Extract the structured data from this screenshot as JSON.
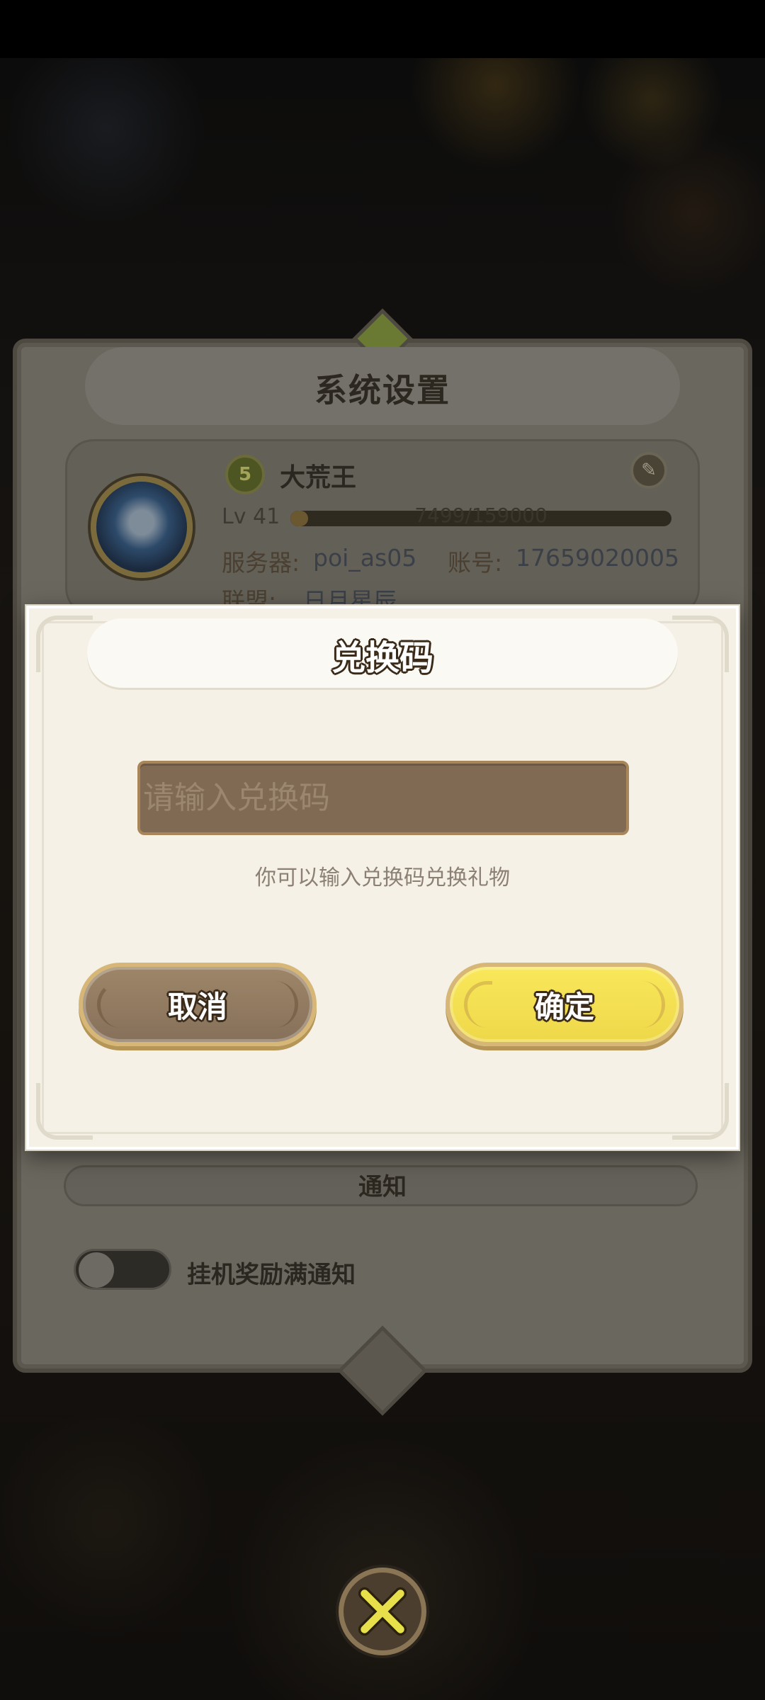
{
  "settings": {
    "title": "系统设置",
    "player": {
      "rank": "5",
      "name": "大荒王",
      "level_label": "Lv 41",
      "exp_text": "7499/159000",
      "exp_fraction": 0.047,
      "server_label": "服务器:",
      "server_value": "poi_as05",
      "account_label": "账号:",
      "account_value": "17659020005",
      "alliance_label": "联盟:",
      "alliance_value": "日月星辰"
    },
    "notify_title": "通知",
    "toggle_label": "挂机奖励满通知",
    "toggle_on": false
  },
  "dialog": {
    "title": "兑换码",
    "input_placeholder": "请输入兑换码",
    "input_value": "",
    "hint": "你可以输入兑换码兑换礼物",
    "cancel_label": "取消",
    "confirm_label": "确定"
  },
  "colors": {
    "confirm_yellow": "#f3e150",
    "cancel_brown": "#927a60",
    "dialog_bg": "#f5f1e7",
    "close_x": "#e8e04a"
  },
  "icons": {
    "close": "close-x-icon",
    "edit": "feather-icon",
    "rank": "rank-badge-icon"
  }
}
